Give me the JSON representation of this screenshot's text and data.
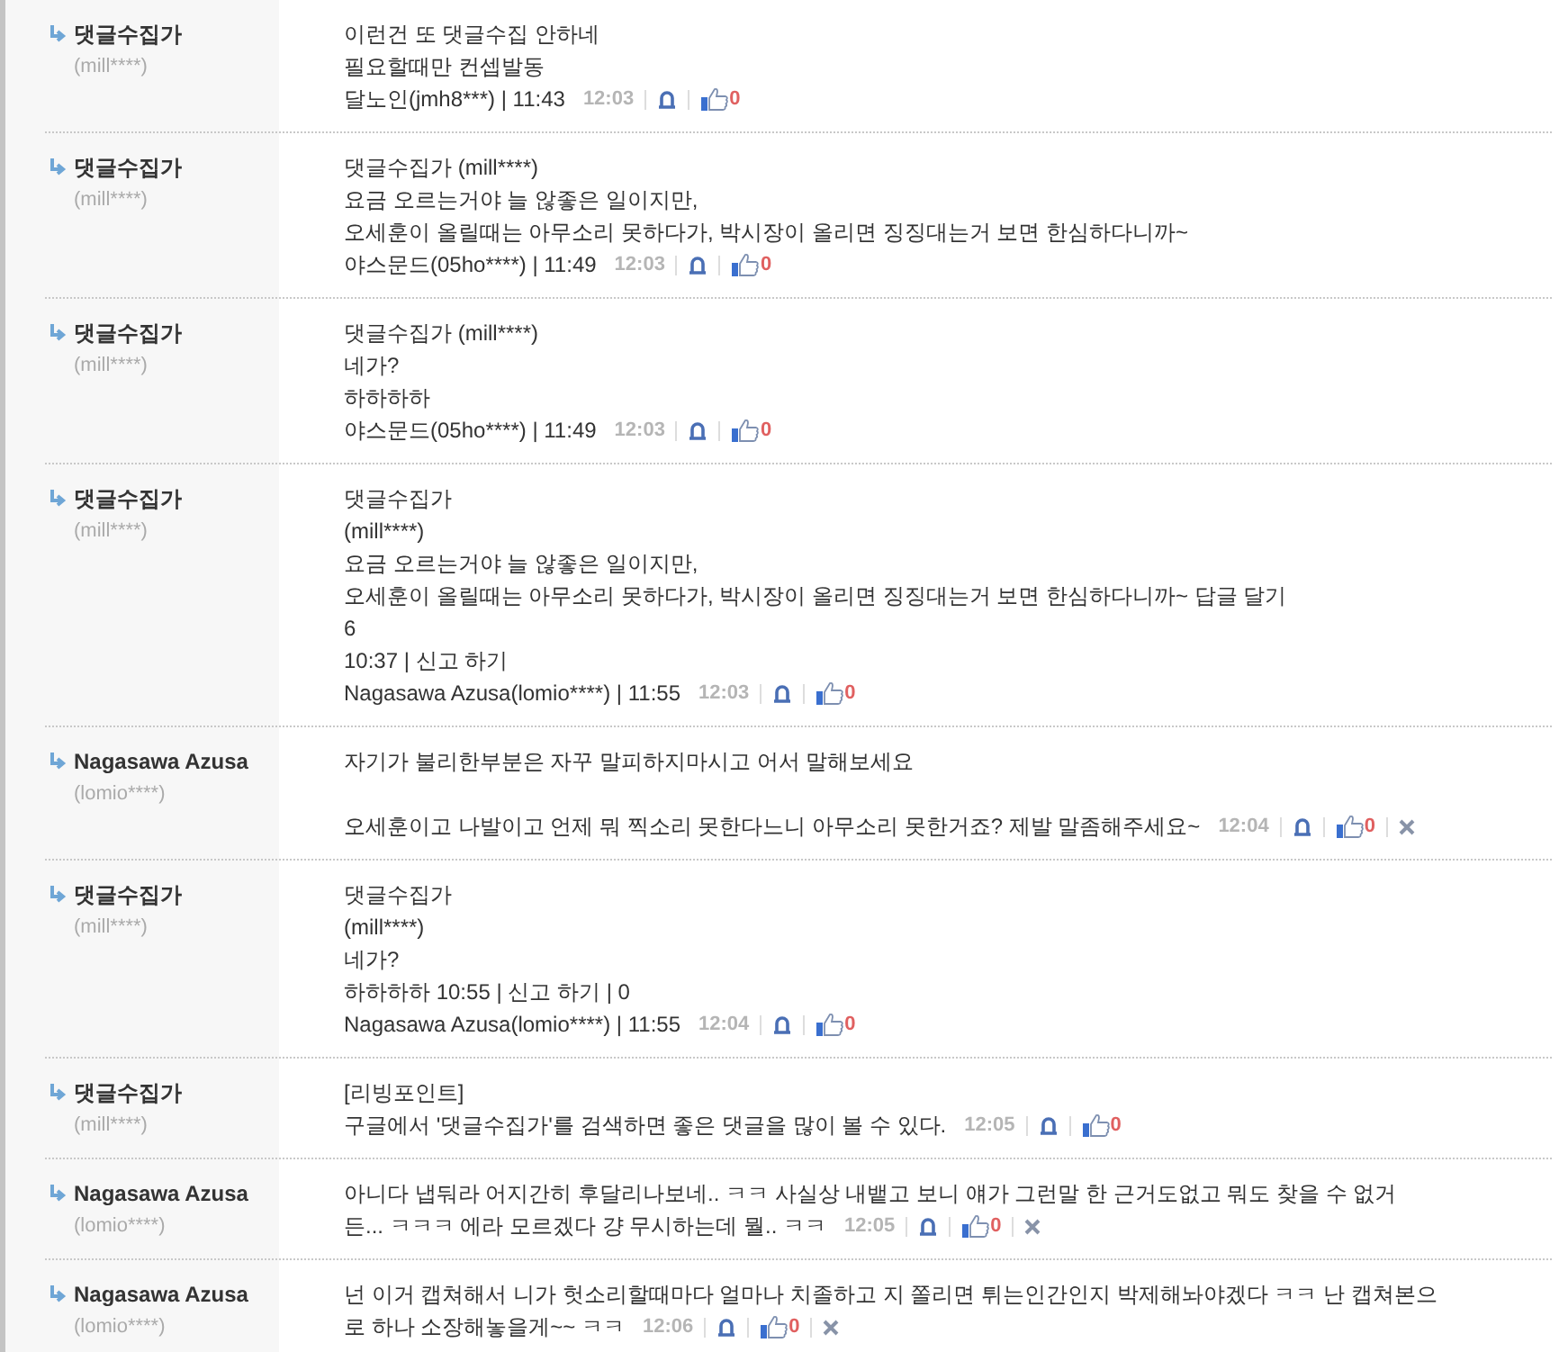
{
  "comments": [
    {
      "author": "댓글수집가",
      "author_id": "(mill****)",
      "paragraphs": [
        [
          "이런건 또 댓글수집 안하네",
          "필요할때만 컨셉발동",
          "달노인(jmh8***) | 11:43"
        ]
      ],
      "time": "12:03",
      "likes": "0",
      "deletable": false
    },
    {
      "author": "댓글수집가",
      "author_id": "(mill****)",
      "paragraphs": [
        [
          "댓글수집가 (mill****)",
          "요금 오르는거야 늘 않좋은 일이지만,",
          "오세훈이 올릴때는 아무소리 못하다가, 박시장이 올리면 징징대는거 보면 한심하다니까~",
          "야스문드(05ho****) | 11:49"
        ]
      ],
      "time": "12:03",
      "likes": "0",
      "deletable": false
    },
    {
      "author": "댓글수집가",
      "author_id": "(mill****)",
      "paragraphs": [
        [
          "댓글수집가 (mill****)",
          "네가?",
          "하하하하",
          "야스문드(05ho****) | 11:49"
        ]
      ],
      "time": "12:03",
      "likes": "0",
      "deletable": false
    },
    {
      "author": "댓글수집가",
      "author_id": "(mill****)",
      "paragraphs": [
        [
          "댓글수집가",
          "(mill****)",
          "요금 오르는거야 늘 않좋은 일이지만,",
          "오세훈이 올릴때는 아무소리 못하다가, 박시장이 올리면 징징대는거 보면 한심하다니까~ 답글 달기",
          "6",
          "10:37 | 신고 하기",
          "Nagasawa Azusa(lomio****) | 11:55"
        ]
      ],
      "time": "12:03",
      "likes": "0",
      "deletable": false
    },
    {
      "author": "Nagasawa Azusa",
      "author_id": "(lomio****)",
      "paragraphs": [
        [
          "자기가 불리한부분은 자꾸 말피하지마시고 어서 말해보세요"
        ],
        [
          "오세훈이고 나발이고 언제 뭐 찍소리 못한다느니 아무소리 못한거죠? 제발 말좀해주세요~"
        ]
      ],
      "time": "12:04",
      "likes": "0",
      "deletable": true
    },
    {
      "author": "댓글수집가",
      "author_id": "(mill****)",
      "paragraphs": [
        [
          "댓글수집가",
          "(mill****)",
          "네가?",
          "하하하하 10:55 | 신고 하기 | 0",
          "Nagasawa Azusa(lomio****) | 11:55"
        ]
      ],
      "time": "12:04",
      "likes": "0",
      "deletable": false
    },
    {
      "author": "댓글수집가",
      "author_id": "(mill****)",
      "paragraphs": [
        [
          "[리빙포인트]",
          "구글에서 '댓글수집가'를 검색하면 좋은 댓글을 많이 볼 수 있다."
        ]
      ],
      "time": "12:05",
      "likes": "0",
      "deletable": false
    },
    {
      "author": "Nagasawa Azusa",
      "author_id": "(lomio****)",
      "paragraphs": [
        [
          "아니다 냅둬라 어지간히 후달리나보네.. ㅋㅋ 사실상 내뱉고 보니 얘가 그런말 한 근거도없고 뭐도 찾을 수 없거",
          "든... ㅋㅋㅋ 에라 모르겠다 걍 무시하는데 뭘.. ㅋㅋ"
        ]
      ],
      "time": "12:05",
      "likes": "0",
      "deletable": true
    },
    {
      "author": "Nagasawa Azusa",
      "author_id": "(lomio****)",
      "paragraphs": [
        [
          "넌 이거 캡쳐해서 니가 헛소리할때마다 얼마나 치졸하고 지 쫄리면 튀는인간인지 박제해놔야겠다 ㅋㅋ 난 캡쳐본으",
          "로 하나 소장해놓을게~~ ㅋㅋ"
        ]
      ],
      "time": "12:06",
      "likes": "0",
      "deletable": true
    }
  ]
}
